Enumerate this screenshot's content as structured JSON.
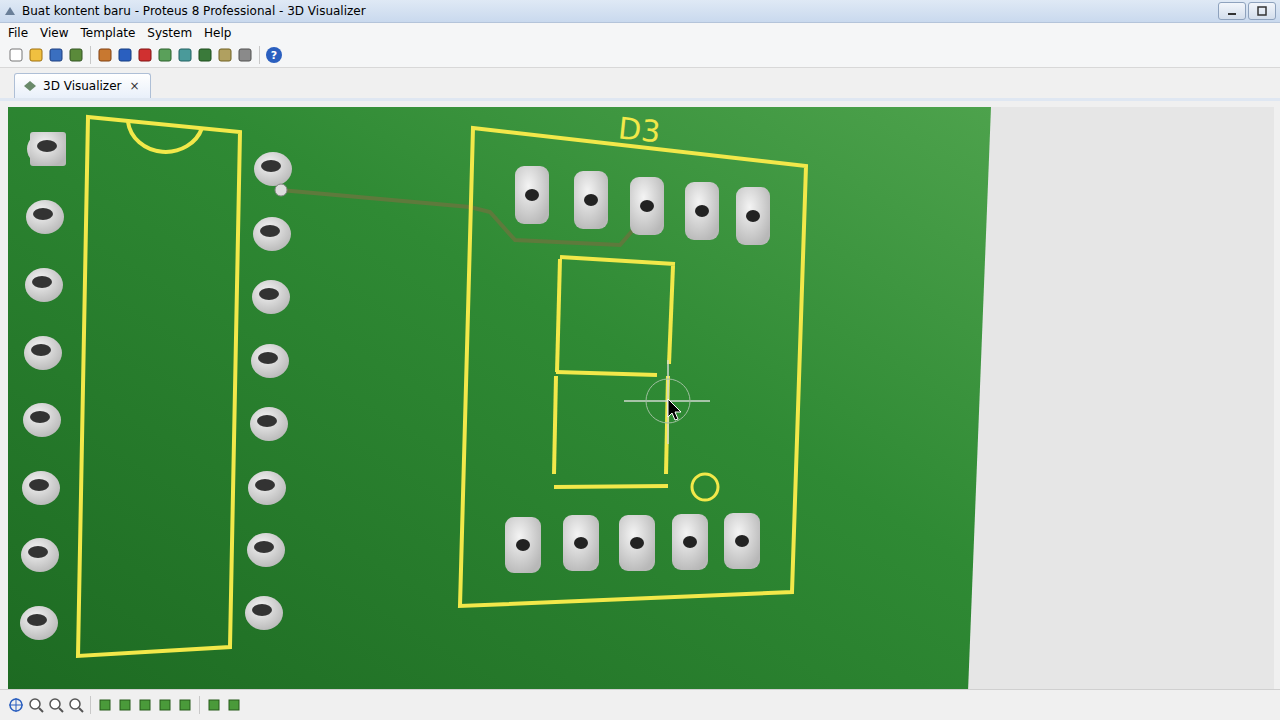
{
  "window": {
    "title": "Buat kontent baru - Proteus 8 Professional - 3D Visualizer"
  },
  "menu": [
    "File",
    "View",
    "Template",
    "System",
    "Help"
  ],
  "toolbar": {
    "help": "?"
  },
  "tabs": [
    {
      "label": "3D Visualizer",
      "selected": true,
      "close": "×"
    }
  ],
  "board": {
    "components": [
      {
        "label": "D3"
      }
    ]
  }
}
